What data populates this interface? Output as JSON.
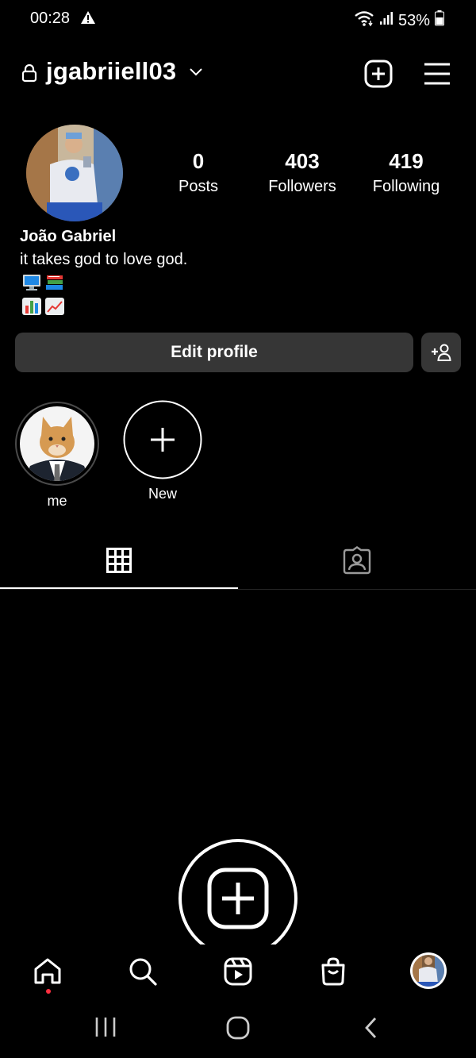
{
  "status_bar": {
    "time": "00:28",
    "alert_icon": "warning-triangle-icon",
    "battery": "53%"
  },
  "header": {
    "username": "jgabriiell03",
    "lock_icon": "lock-icon",
    "dropdown_icon": "chevron-down-icon",
    "new_post_icon": "plus-square-icon",
    "menu_icon": "hamburger-menu-icon"
  },
  "profile": {
    "stats": [
      {
        "count": "0",
        "label": "Posts"
      },
      {
        "count": "403",
        "label": "Followers"
      },
      {
        "count": "419",
        "label": "Following"
      }
    ],
    "name": "João Gabriel",
    "bio": "it takes god to love god.",
    "bio_emojis": [
      [
        "desktop-computer-emoji",
        "books-emoji"
      ],
      [
        "bar-chart-emoji",
        "chart-increasing-emoji"
      ]
    ]
  },
  "actions": {
    "edit_profile": "Edit profile",
    "add_person_icon": "add-person-icon"
  },
  "highlights": [
    {
      "label": "me"
    },
    {
      "label": "New"
    }
  ],
  "tabs": [
    {
      "name": "grid",
      "icon": "grid-icon",
      "active": true
    },
    {
      "name": "tagged",
      "icon": "tagged-person-icon",
      "active": false
    }
  ],
  "bottom_nav": [
    {
      "name": "home",
      "icon": "home-icon",
      "notification_dot": true
    },
    {
      "name": "search",
      "icon": "search-icon"
    },
    {
      "name": "reels",
      "icon": "reels-icon"
    },
    {
      "name": "shop",
      "icon": "shopping-bag-icon"
    },
    {
      "name": "profile",
      "icon": "avatar"
    }
  ],
  "system_nav": [
    "recents-icon",
    "home-circle-icon",
    "back-icon"
  ],
  "colors": {
    "background": "#000000",
    "button": "#363636",
    "notification": "#ff3040"
  }
}
